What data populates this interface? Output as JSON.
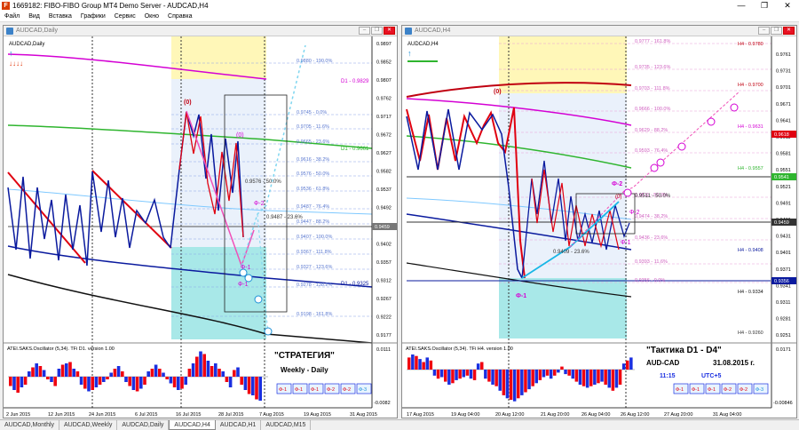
{
  "window": {
    "title": "1669182: FIBO-FIBO Group MT4 Demo Server - AUDCAD,H4",
    "min": "—",
    "max": "❐",
    "close": "✕"
  },
  "menu": [
    "Файл",
    "Вид",
    "Вставка",
    "Графики",
    "Сервис",
    "Окно",
    "Справка"
  ],
  "left": {
    "window_title": "AUDCAD,Daily",
    "symbol_label": "AUDCAD,Daily",
    "prices": [
      "0.9897",
      "0.9852",
      "0.9807",
      "0.9762",
      "0.9717",
      "0.9672",
      "0.9627",
      "0.9582",
      "0.9537",
      "0.9492",
      "0.9459",
      "0.9402",
      "0.9357",
      "0.9312",
      "0.9267",
      "0.9222",
      "0.9177"
    ],
    "current_price": "0.9459",
    "fibo_labels": [
      "0.9880 - 190.0%",
      "0.9745 - 0.0%",
      "0.9705 - 11.6%",
      "0.9665 - 23.6%",
      "0.9616 - 38.2%",
      "0.9576 - 50.0%",
      "0.9536 - 61.8%",
      "0.9487 - 76.4%",
      "0.9447 - 88.2%",
      "0.9407 - 100.0%",
      "0.9367 - 111.8%",
      "0.9327 - 123.6%",
      "0.9278 - 138.2%",
      "0.9198 - 161.8%"
    ],
    "d1_labels": [
      "D1 - 0.9829",
      "D1 - 0.9661",
      "D1 - 0.9325"
    ],
    "extra_labels": [
      "0.9576 - 50.0%",
      "0.9487 - 23.6%"
    ],
    "wave_labels": [
      "(0)",
      "(0)",
      "Ф-2",
      "Ф-1",
      "Ф-1"
    ],
    "osc_label": "ATEI.SAKS.Oscillator (5,34). TFi D1. version 1.00",
    "osc_values": [
      "0.0111",
      "-0.0082"
    ],
    "strategy_title": "\"СТРАТЕГИЯ\"",
    "strategy_sub": "Weekly - Daily",
    "buttons": [
      "Ф-1",
      "Ф-1",
      "Ф-1",
      "Ф-2",
      "Ф-2",
      "Ф-3"
    ],
    "dates": [
      "2 Jun 2015",
      "12 Jun 2015",
      "24 Jun 2015",
      "6 Jul 2015",
      "16 Jul 2015",
      "28 Jul 2015",
      "7 Aug 2015",
      "19 Aug 2015",
      "31 Aug 2015"
    ]
  },
  "right": {
    "window_title": "AUDCAD,H4",
    "symbol_label": "AUDCAD,H4",
    "prices": [
      "0.9761",
      "0.9731",
      "0.9701",
      "0.9671",
      "0.9641",
      "0.9611",
      "0.9581",
      "0.9551",
      "0.9521",
      "0.9491",
      "0.9461",
      "0.9431",
      "0.9401",
      "0.9371",
      "0.9341",
      "0.9311",
      "0.9281",
      "0.9251"
    ],
    "tags": [
      "0.9618",
      "0.9541",
      "0.9459",
      "0.9356"
    ],
    "fibo_labels": [
      "0.9777 - 161.8%",
      "0.9735 - 123.6%",
      "0.9703 - 111.8%",
      "0.9666 - 100.0%",
      "0.9629 - 88.2%",
      "0.9593 - 76.4%",
      "0.9511 - 50.0%",
      "0.9474 - 38.2%",
      "0.9436 - 23.6%",
      "0.9393 - 11.6%",
      "0.9356 - 0.0%"
    ],
    "h4_labels": [
      "H4 - 0.9780",
      "H4 - 0.9700",
      "H4 - 0.9631",
      "H4 - 0.9557",
      "H4 - 0.9408",
      "H4 - 0.9334",
      "H4 - 0.9260"
    ],
    "extra_labels": [
      "0.9409 - 23.6%",
      "0.9511 - 50.0%"
    ],
    "wave_labels": [
      "(0)",
      "(0)",
      "Ф-2",
      "Ф-2",
      "Ф-1",
      "Ф-1"
    ],
    "osc_label": "ATEI.SAKS.Oscillator (5,34). TFi H4. version 1.00",
    "osc_values": [
      "0.0171",
      "-0.00846"
    ],
    "tactic_title": "\"Тактика  D1 - D4\"",
    "pair": "AUD-CAD",
    "date": "31.08.2015 г.",
    "time": "11:15",
    "utc": "UTC+5",
    "buttons": [
      "Ф-1",
      "Ф-1",
      "Ф-1",
      "Ф-2",
      "Ф-2",
      "Ф-3"
    ],
    "dates": [
      "17 Aug 2015",
      "19 Aug 04:00",
      "20 Aug 12:00",
      "21 Aug 20:00",
      "26 Aug 04:00",
      "26 Aug 12:00",
      "27 Aug 20:00",
      "31 Aug 04:00"
    ]
  },
  "tabs": [
    "AUDCAD,Monthly",
    "AUDCAD,Weekly",
    "AUDCAD,Daily",
    "AUDCAD,H4",
    "AUDCAD,H1",
    "AUDCAD,M15"
  ],
  "active_tab": 3,
  "colors": {
    "bull": "#0a1a9e",
    "bear": "#e00010",
    "magenta": "#d400d4",
    "green": "#2fb52f",
    "fibo": "#6e8fe0",
    "hist_red": "#f0000f",
    "hist_blue": "#1a2fe0",
    "cyan_zone": "#a8e8e8",
    "yellow_zone": "#fff7b8"
  }
}
